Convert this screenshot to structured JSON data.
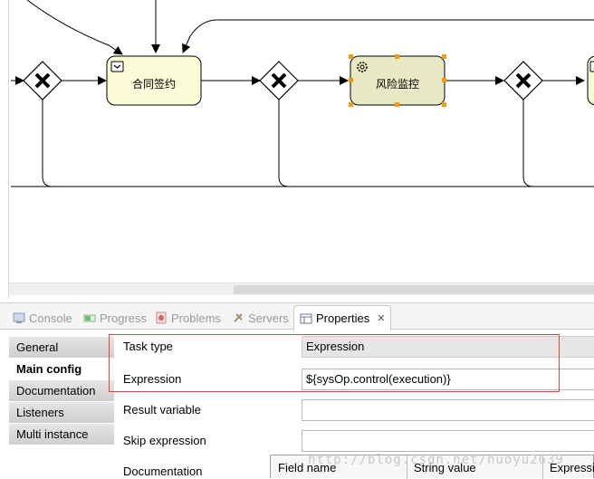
{
  "diagram": {
    "tasks": [
      {
        "name": "合同签约",
        "icon": "user-task-icon",
        "selected": false
      },
      {
        "name": "风险监控",
        "icon": "service-task-gear-icon",
        "selected": true
      }
    ],
    "gateway_icon": "exclusive-gateway-x-icon"
  },
  "view_tabs": [
    {
      "label": "Console",
      "icon": "console-icon"
    },
    {
      "label": "Progress",
      "icon": "progress-icon"
    },
    {
      "label": "Problems",
      "icon": "problems-icon"
    },
    {
      "label": "Servers",
      "icon": "servers-icon"
    },
    {
      "label": "Properties",
      "icon": "properties-icon",
      "active": true
    }
  ],
  "properties": {
    "side_tabs": [
      "General",
      "Main config",
      "Documentation",
      "Listeners",
      "Multi instance"
    ],
    "active_side_tab": "Main config",
    "fields": {
      "task_type": {
        "label": "Task type",
        "value": "Expression"
      },
      "expression": {
        "label": "Expression",
        "value": "${sysOp.control(execution)}"
      },
      "result_variable": {
        "label": "Result variable",
        "value": ""
      },
      "skip_expression": {
        "label": "Skip expression",
        "value": ""
      },
      "documentation": {
        "label": "Documentation"
      }
    },
    "field_table_headers": [
      "Field name",
      "String value",
      "Expressio"
    ]
  },
  "watermark": "http://blog.csdn.net/huoyu2639",
  "colors": {
    "selection_handle": "#f39c12",
    "highlight_box": "#d04848",
    "task_fill": "#fbfbd8",
    "selected_task_fill": "#e8e8c4"
  }
}
